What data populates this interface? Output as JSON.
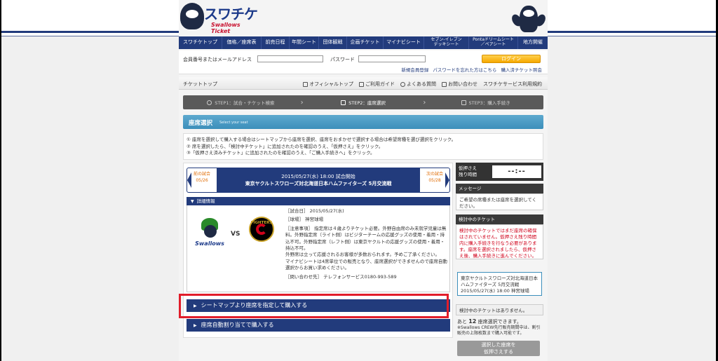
{
  "logo": {
    "main": "スワチケ",
    "sub": "Swallows Ticket"
  },
  "nav": [
    {
      "label": "スワチケトップ",
      "w": 62
    },
    {
      "label": "価格／座席表",
      "w": 56
    },
    {
      "label": "前売日程",
      "w": 40
    },
    {
      "label": "年間シート",
      "w": 42
    },
    {
      "label": "団体観戦",
      "w": 40
    },
    {
      "label": "企画チケット",
      "w": 52
    },
    {
      "label": "マイナビシート",
      "w": 58
    },
    {
      "label": "セブン-イレブン\nデッキシート",
      "w": 64
    },
    {
      "label": "Pontaドリームシート\n／ペアシート",
      "w": 70
    },
    {
      "label": "地方開催",
      "w": 42
    }
  ],
  "login": {
    "id_label": "会員番号またはメールアドレス",
    "pw_label": "パスワード",
    "button": "ログイン",
    "links": [
      "新規会員登録",
      "パスワードを忘れた方はこちら",
      "購入済チケット照会"
    ]
  },
  "subnav": {
    "crumb": "チケットトップ",
    "links": [
      "オフィシャルトップ",
      "ご利用ガイド",
      "よくある質問",
      "お問い合わせ",
      "スワチケサービス利用規約"
    ]
  },
  "steps": [
    {
      "label": "STEP1：試合・チケット検索"
    },
    {
      "label": "STEP2：座席選択"
    },
    {
      "label": "STEP3：購入手続き"
    }
  ],
  "section": {
    "title": "座席選択",
    "subtitle": "Select your seat"
  },
  "instructions": [
    "① 座席を選択して購入する場合はシートマップから座席を選択、座席をおまかせで選択する場合は希望席種を選び選択をクリック。",
    "② 席を選択したら、「検討中チケット」に追加されたのを確認のうえ、「仮押さえ」をクリック。",
    "③「仮押さえ済みチケット」に追加されたのを確認のうえ、「ご購入手続きへ」をクリック。"
  ],
  "game": {
    "prev_label": "前の試合",
    "prev_date": "05/26",
    "next_label": "次の試合",
    "next_date": "05/28",
    "datetime": "2015/05/27(水) 18:00 試合開始",
    "matchup": "東京ヤクルトスワローズ対北海道日本ハムファイターズ 5月交流戦"
  },
  "detail": {
    "bar_label": "詳細情報",
    "home_team": "Swallows",
    "vs": "VS",
    "away_team": "FIGHTERS",
    "date_line": "［試合日］ 2015/05/27(水)",
    "venue_line": "［球場］ 神宮球場",
    "notice": "［注意事項］ 指定席は４歳よりチケット必要。外野自由席のみ未就学児童は無料。外野指定席（ライト側）はビジターチームの応援グッズの使用・着用・持込不可。外野指定席（レフト側）は東京ヤクルトの応援グッズの使用・着用・持込不可。",
    "notice2": "外野席は立って応援されるお客様が多数おられます。予めご了承ください。",
    "notice3": "マイナビシートは4席単位での販売となり、座席選択ができませんので座席自動選択からお買い求めください。",
    "contact_line": "［問い合わせ先］ テレフォンサービス0180-993-589"
  },
  "buttons": {
    "seatmap": "シートマップより座席を指定して購入する",
    "auto": "座席自動割り当てで購入する"
  },
  "side": {
    "hold_label_1": "仮押さえ",
    "hold_label_2": "残り時間",
    "timer": "--:--",
    "msg_head": "メッセージ",
    "msg": "ご希望の席種または座席を選択してください。",
    "check_head": "検討中のチケット",
    "check_msg": "検討中のチケットではまだ座席の確保はされていません。仮押さえ残り時間内に購入手続きを行なう必要があります。座席を選択されましたら、仮押さえ後、購入手続きに進んでください。",
    "game_box": "東京ヤクルトスワローズ対北海道日本ハムファイターズ 5月交流戦 2015/05/27(水) 18:00 神宮球場",
    "none_msg": "検討中のチケットはありません。",
    "remain_pre": "あと",
    "remain_num": "12",
    "remain_post": "座席選択できます。",
    "remain_note": "※Swallows CREW先行販売期間中は、割引販売の上限枚数まで購入可能です。",
    "hold_button_1": "選択した座席を",
    "hold_button_2": "仮押さえする"
  },
  "colors": {
    "navy": "#223b7c",
    "accent_blue": "#3c8fbb",
    "highlight_red": "#e11d2a",
    "login_orange": "#f6a800"
  }
}
